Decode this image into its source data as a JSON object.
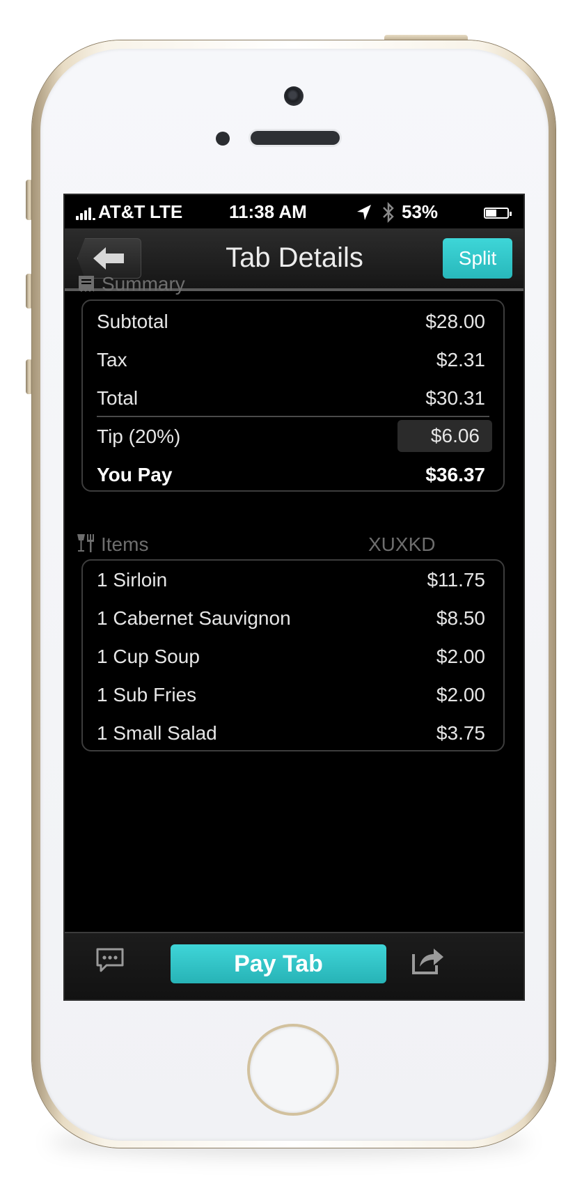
{
  "status": {
    "carrier": "AT&T",
    "network": "LTE",
    "time": "11:38 AM",
    "battery": "53%",
    "battery_level": 0.53,
    "signal_bars": 4
  },
  "nav": {
    "title": "Tab Details",
    "back_icon": "back-arrow-icon",
    "split_label": "Split"
  },
  "summary": {
    "heading": "Summary",
    "icon": "receipt-icon",
    "rows": [
      {
        "label": "Subtotal",
        "value": "$28.00"
      },
      {
        "label": "Tax",
        "value": "$2.31"
      },
      {
        "label": "Total",
        "value": "$30.31"
      }
    ],
    "tip": {
      "label": "Tip (20%)",
      "value": "$6.06"
    },
    "you_pay": {
      "label": "You Pay",
      "value": "$36.37"
    }
  },
  "items": {
    "heading": "Items",
    "icon": "dining-icon",
    "code": "XUXKD",
    "list": [
      {
        "name": "1 Sirloin",
        "price": "$11.75"
      },
      {
        "name": "1 Cabernet Sauvignon",
        "price": "$8.50"
      },
      {
        "name": "1 Cup Soup",
        "price": "$2.00"
      },
      {
        "name": "1 Sub Fries",
        "price": "$2.00"
      },
      {
        "name": "1 Small Salad",
        "price": "$3.75"
      }
    ]
  },
  "toolbar": {
    "pay_label": "Pay Tab",
    "chat_icon": "chat-icon",
    "share_icon": "share-icon"
  },
  "colors": {
    "accent": "#2fc6c9",
    "background": "#000000",
    "phone_trim": "#d2c19e"
  }
}
